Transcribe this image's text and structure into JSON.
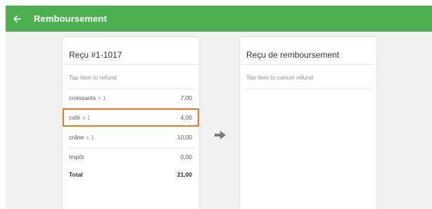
{
  "appbar": {
    "title": "Remboursement",
    "back_icon": "arrow-left-icon",
    "color": "#4caf50"
  },
  "receipt": {
    "title": "Reçu #1-1017",
    "hint": "Tap item to refund",
    "items": [
      {
        "name": "croissants",
        "qty": "x 1",
        "price": "7,00"
      },
      {
        "name": "café",
        "qty": "x 1",
        "price": "4,00",
        "selected": true
      },
      {
        "name": "crâne",
        "qty": "x 1",
        "price": "10,00"
      }
    ],
    "tax": {
      "label": "Impôt",
      "amount": "0,00"
    },
    "total": {
      "label": "Total",
      "amount": "21,00"
    }
  },
  "refund": {
    "title": "Reçu de remboursement",
    "hint": "Tap item to cancel refund"
  },
  "transfer_icon": "arrow-right-icon",
  "highlight_color": "#e8792b"
}
